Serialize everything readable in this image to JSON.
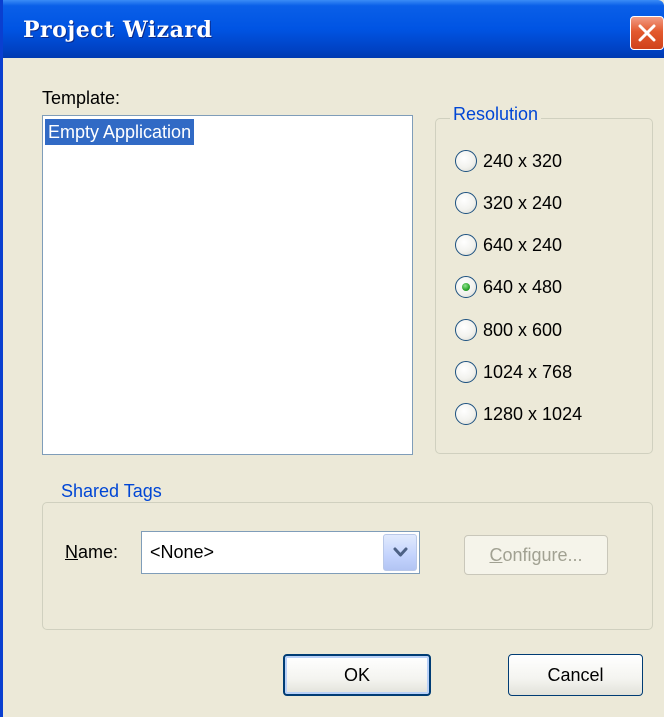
{
  "window": {
    "title": "Project Wizard"
  },
  "template": {
    "label": "Template:",
    "items": [
      "Empty Application"
    ],
    "selected": "Empty Application"
  },
  "resolution": {
    "legend": "Resolution",
    "options": [
      "240 x 320",
      "320 x 240",
      "640 x 240",
      "640 x 480",
      "800 x 600",
      "1024 x 768",
      "1280 x 1024"
    ],
    "selected": "640 x 480"
  },
  "shared_tags": {
    "legend": "Shared Tags",
    "name_label_accel": "N",
    "name_label_rest": "ame:",
    "name_value": "<None>",
    "configure_accel": "C",
    "configure_rest": "onfigure..."
  },
  "buttons": {
    "ok": "OK",
    "cancel": "Cancel"
  },
  "colors": {
    "titlebar": "#0054e3",
    "selection": "#316ac5",
    "group_legend": "#0046d5",
    "dialog_bg": "#ece9d8"
  },
  "icons": {
    "close": "close-icon",
    "dropdown": "chevron-down-icon"
  }
}
